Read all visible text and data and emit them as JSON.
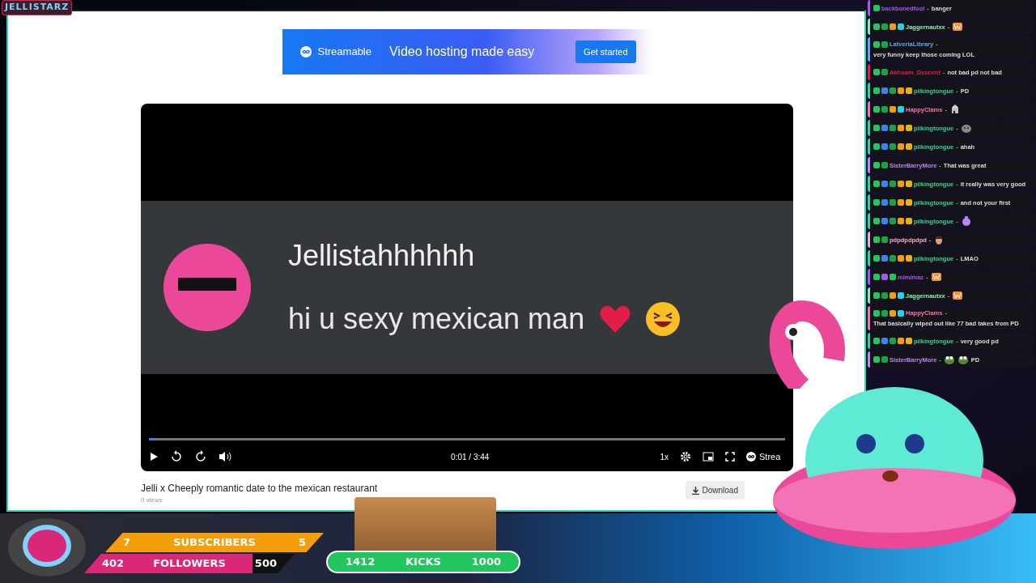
{
  "overlay_logo": "JELLISTARZ",
  "ad": {
    "brand": "Streamable",
    "headline": "Video hosting made easy",
    "button": "Get started"
  },
  "video": {
    "sender": "Jellistahhhhhh",
    "message": "hi u sexy mexican man",
    "progress": {
      "level": 0.012
    },
    "time": "0:01 / 3:44",
    "speed": "1x",
    "brand": "Strea",
    "title": "Jelli x Cheeply romantic date to the mexican restaurant",
    "views": "0 views",
    "download": "Download"
  },
  "chat": [
    {
      "badges": [
        {
          "kind": "kick"
        }
      ],
      "user": "backbonedfool",
      "color": "#a855f7",
      "sep": "-",
      "parts": [
        {
          "kind": "text",
          "text": "banger"
        }
      ]
    },
    {
      "badges": [
        {
          "kind": "kick"
        },
        {
          "kind": "hat"
        },
        {
          "kind": "coin"
        },
        {
          "kind": "gift"
        }
      ],
      "user": "Jaggernautxx",
      "color": "#86efac",
      "sep": "-",
      "parts": [
        {
          "kind": "w"
        }
      ]
    },
    {
      "badges": [
        {
          "kind": "kick"
        },
        {
          "kind": "hat"
        }
      ],
      "user": "LatveriaLibrary",
      "color": "#60a5fa",
      "sep": "-",
      "parts": [
        {
          "kind": "text",
          "text": "very funny keep those coming LOL"
        }
      ]
    },
    {
      "badges": [
        {
          "kind": "kick"
        },
        {
          "kind": "hat"
        }
      ],
      "user": "Akhoam_Descent",
      "color": "#e11d48",
      "sep": "-",
      "parts": [
        {
          "kind": "text",
          "text": "not bad pd not bad"
        }
      ]
    },
    {
      "badges": [
        {
          "kind": "kick"
        },
        {
          "kind": "sub"
        },
        {
          "kind": "hat"
        },
        {
          "kind": "coin"
        },
        {
          "kind": "crown"
        }
      ],
      "user": "pilkingtongue",
      "color": "#34d399",
      "sep": "-",
      "parts": [
        {
          "kind": "text",
          "text": "PD"
        }
      ]
    },
    {
      "badges": [
        {
          "kind": "kick"
        },
        {
          "kind": "hat"
        },
        {
          "kind": "coin"
        },
        {
          "kind": "gift"
        }
      ],
      "user": "HappyClams",
      "color": "#f472b6",
      "sep": "-",
      "parts": [
        {
          "kind": "hand"
        }
      ]
    },
    {
      "badges": [
        {
          "kind": "kick"
        },
        {
          "kind": "sub"
        },
        {
          "kind": "hat"
        },
        {
          "kind": "coin"
        },
        {
          "kind": "crown"
        }
      ],
      "user": "pilkingtongue",
      "color": "#34d399",
      "sep": "-",
      "parts": [
        {
          "kind": "blob"
        }
      ]
    },
    {
      "badges": [
        {
          "kind": "kick"
        },
        {
          "kind": "sub"
        },
        {
          "kind": "hat"
        },
        {
          "kind": "coin"
        },
        {
          "kind": "crown"
        }
      ],
      "user": "pilkingtongue",
      "color": "#34d399",
      "sep": "-",
      "parts": [
        {
          "kind": "text",
          "text": "ahah"
        }
      ]
    },
    {
      "badges": [
        {
          "kind": "kick"
        },
        {
          "kind": "hat"
        }
      ],
      "user": "SisterBarryMore",
      "color": "#c084fc",
      "sep": "-",
      "parts": [
        {
          "kind": "text",
          "text": "That was great"
        }
      ]
    },
    {
      "badges": [
        {
          "kind": "kick"
        },
        {
          "kind": "sub"
        },
        {
          "kind": "hat"
        },
        {
          "kind": "coin"
        },
        {
          "kind": "crown"
        }
      ],
      "user": "pilkingtongue",
      "color": "#34d399",
      "sep": "-",
      "parts": [
        {
          "kind": "text",
          "text": "it really was very good"
        }
      ]
    },
    {
      "badges": [
        {
          "kind": "kick"
        },
        {
          "kind": "sub"
        },
        {
          "kind": "hat"
        },
        {
          "kind": "coin"
        },
        {
          "kind": "crown"
        }
      ],
      "user": "pilkingtongue",
      "color": "#34d399",
      "sep": "-",
      "parts": [
        {
          "kind": "text",
          "text": "and not your first"
        }
      ]
    },
    {
      "badges": [
        {
          "kind": "kick"
        },
        {
          "kind": "sub"
        },
        {
          "kind": "hat"
        },
        {
          "kind": "coin"
        },
        {
          "kind": "crown"
        }
      ],
      "user": "pilkingtongue",
      "color": "#34d399",
      "sep": "-",
      "parts": [
        {
          "kind": "potion"
        }
      ]
    },
    {
      "badges": [
        {
          "kind": "kick"
        },
        {
          "kind": "hat"
        }
      ],
      "user": "pdpdpdpdpd",
      "color": "#f9a8d4",
      "sep": "-",
      "parts": [
        {
          "kind": "face"
        }
      ]
    },
    {
      "badges": [
        {
          "kind": "kick"
        },
        {
          "kind": "sub"
        },
        {
          "kind": "hat"
        },
        {
          "kind": "coin"
        },
        {
          "kind": "crown"
        }
      ],
      "user": "pilkingtongue",
      "color": "#34d399",
      "sep": "-",
      "parts": [
        {
          "kind": "text",
          "text": "LMAO"
        }
      ]
    },
    {
      "badges": [
        {
          "kind": "kick"
        },
        {
          "kind": "gem"
        },
        {
          "kind": "check"
        }
      ],
      "user": "mimimaz",
      "color": "#a855f7",
      "sep": "-",
      "parts": [
        {
          "kind": "w"
        }
      ]
    },
    {
      "badges": [
        {
          "kind": "kick"
        },
        {
          "kind": "hat"
        },
        {
          "kind": "coin"
        },
        {
          "kind": "gift"
        }
      ],
      "user": "Jaggernautxx",
      "color": "#86efac",
      "sep": "-",
      "parts": [
        {
          "kind": "w"
        }
      ]
    },
    {
      "badges": [
        {
          "kind": "kick"
        },
        {
          "kind": "hat"
        },
        {
          "kind": "coin"
        },
        {
          "kind": "gift"
        }
      ],
      "user": "HappyClams",
      "color": "#f472b6",
      "sep": "-",
      "parts": [
        {
          "kind": "text",
          "text": "That basically wiped out like 77 bad takes from PD"
        }
      ]
    },
    {
      "badges": [
        {
          "kind": "kick"
        },
        {
          "kind": "sub"
        },
        {
          "kind": "hat"
        },
        {
          "kind": "coin"
        },
        {
          "kind": "crown"
        }
      ],
      "user": "pilkingtongue",
      "color": "#34d399",
      "sep": "-",
      "parts": [
        {
          "kind": "text",
          "text": "very good pd"
        }
      ]
    },
    {
      "badges": [
        {
          "kind": "kick"
        },
        {
          "kind": "hat"
        }
      ],
      "user": "SisterBarryMore",
      "color": "#c084fc",
      "sep": "-",
      "parts": [
        {
          "kind": "frog"
        },
        {
          "kind": "frog"
        },
        {
          "kind": "text",
          "text": "PD"
        }
      ]
    }
  ],
  "goals": [
    {
      "kind": "subscribers",
      "current": "7",
      "label": "SUBSCRIBERS",
      "target": "5"
    },
    {
      "kind": "followers",
      "current": "402",
      "label": "FOLLOWERS",
      "target": "500"
    },
    {
      "kind": "kicks",
      "current": "1412",
      "label": "KICKS",
      "target": "1000"
    }
  ]
}
